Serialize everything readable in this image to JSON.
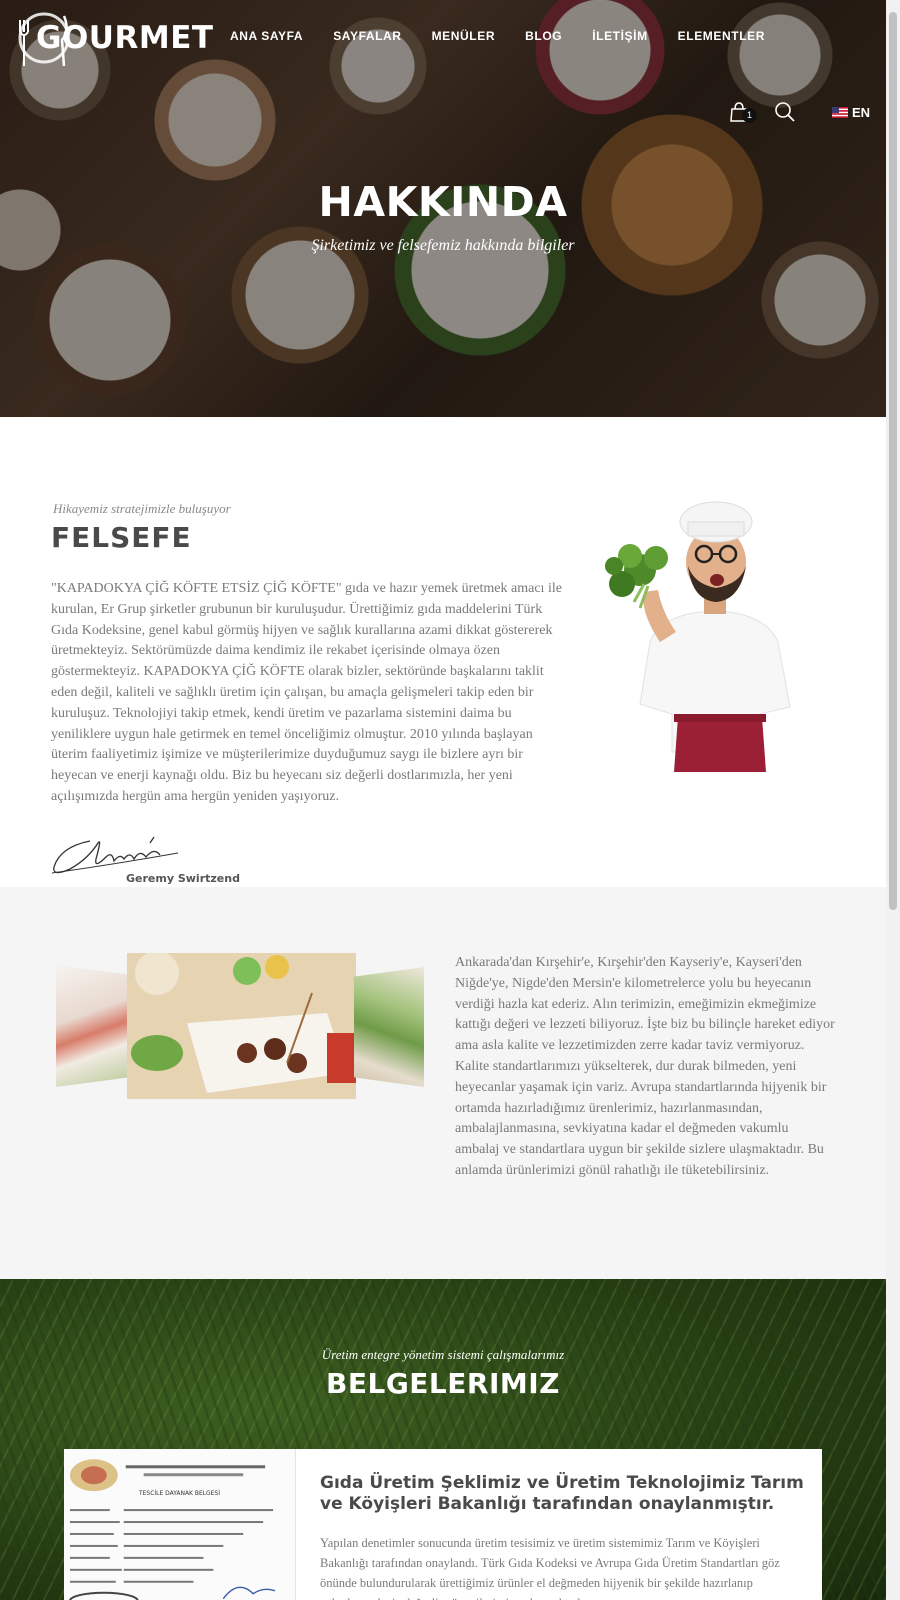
{
  "header": {
    "logo_text": "GOURMET",
    "nav": [
      "ANA SAYFA",
      "SAYFALAR",
      "MENÜLER",
      "BLOG",
      "İLETİŞİM",
      "ELEMENTLER"
    ],
    "cart_count": "1",
    "language": "EN"
  },
  "hero": {
    "title": "HAKKINDA",
    "subtitle": "Şirketimiz ve felsefemiz hakkında bilgiler"
  },
  "felsefe": {
    "kicker": "Hikayemiz stratejimizle buluşuyor",
    "title": "FELSEFE",
    "text": "\"KAPADOKYA ÇİĞ KÖFTE ETSİZ ÇİĞ KÖFTE\" gıda ve hazır yemek üretmek amacı ile kurulan, Er Grup şirketler grubunun bir kuruluşudur. Ürettiğimiz gıda maddelerini Türk Gıda Kodeksine, genel kabul görmüş hijyen ve sağlık kurallarına azami dikkat göstererek üretmekteyiz. Sektörümüzde daima kendimiz ile rekabet içerisinde olmaya özen göstermekteyiz. KAPADOKYA ÇİĞ KÖFTE olarak bizler, sektöründe başkalarını taklit eden değil, kaliteli ve sağlıklı üretim için çalışan, bu amaçla gelişmeleri takip eden bir kuruluşuz. Teknolojiyi takip etmek, kendi üretim ve pazarlama sistemini daima bu yeniliklere uygun hale getirmek en temel önceliğimiz olmuştur. 2010 yılında başlayan üterim faaliyetimiz işimize ve müşterilerimize duyduğumuz saygı ile bizlere ayrı bir heyecan ve enerji kaynağı oldu. Biz bu heyecanı siz değerli dostlarımızla, her yeni açılışımızda hergün ama hergün yeniden yaşıyoruz.",
    "signature_name": "Geremy Swirtzend"
  },
  "story": {
    "text": "Ankarada'dan Kırşehir'e, Kırşehir'den Kayseriy'e, Kayseri'den Niğde'ye, Nigde'den Mersin'e kilometrelerce yolu bu heyecanın verdiği hazla kat ederiz. Alın terimizin, emeğimizin ekmeğimize kattığı değeri ve lezzeti biliyoruz. İşte biz bu bilinçle hareket ediyor ama asla kalite ve lezzetimizden zerre kadar taviz vermiyoruz. Kalite standartlarımızı yükselterek, dur durak bilmeden, yeni heyecanlar yaşamak için variz. Avrupa standartlarında hijyenik bir ortamda hazırladığımız ürenlerimiz, hazırlanmasından, ambalajlanmasına, sevkiyatına kadar el değmeden vakumlu ambalaj ve standartlara uygun bir şekilde sizlere ulaşmaktadır. Bu anlamda ürünlerimizi gönül rahatlığı ile tüketebilirsiniz."
  },
  "belgeler": {
    "kicker": "Üretim entegre yönetim sistemi çalışmalarımız",
    "title": "BELGELERIMIZ",
    "card_heading": "Gıda Üretim Şeklimiz ve Üretim Teknolojimiz Tarım ve Köyişleri Bakanlığı tarafından onaylanmıştır.",
    "card_text": "Yapılan denetimler sonucunda üretim tesisimiz ve üretim sistemimiz Tarım ve Köyişleri Bakanlığı tarafından onaylandı. Türk Gıda Kodeksi ve Avrupa Gıda Üretim Standartları göz önünde bulundurularak ürettiğimiz ürünler el değmeden hijyenik bir şekilde hazırlanıp paketlenerek siz değerli müşterilerimize ulaşmaktadır.",
    "certificate_title": "TESCİLE DAYANAK BELGESİ"
  },
  "colors": {
    "heading": "#4a4a4a",
    "body_text": "#7a7a7a",
    "section_alt_bg": "#f5f5f5",
    "apron": "#9b1f35"
  }
}
